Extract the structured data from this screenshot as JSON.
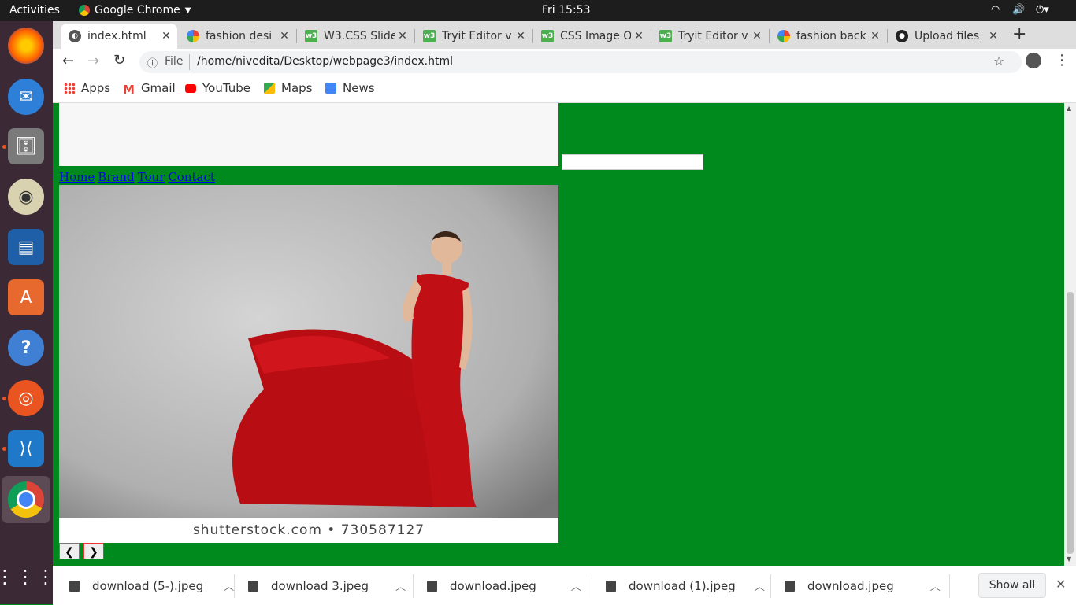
{
  "system": {
    "activities": "Activities",
    "app_name": "Google Chrome",
    "clock": "Fri 15:53"
  },
  "tabs": [
    {
      "title": "index.html",
      "active": true,
      "icon": "globe-icon"
    },
    {
      "title": "fashion desi",
      "icon": "google-icon"
    },
    {
      "title": "W3.CSS Slide",
      "icon": "w3-icon"
    },
    {
      "title": "Tryit Editor v",
      "icon": "w3-icon"
    },
    {
      "title": "CSS Image O",
      "icon": "w3-icon"
    },
    {
      "title": "Tryit Editor v",
      "icon": "w3-icon"
    },
    {
      "title": "fashion back",
      "icon": "google-icon"
    },
    {
      "title": "Upload files",
      "icon": "github-icon"
    }
  ],
  "toolbar": {
    "info_label": "File",
    "url": "/home/nivedita/Desktop/webpage3/index.html"
  },
  "bookmarks": [
    {
      "label": "Apps",
      "icon": "apps-grid-icon"
    },
    {
      "label": "Gmail",
      "icon": "gmail-icon"
    },
    {
      "label": "YouTube",
      "icon": "youtube-icon"
    },
    {
      "label": "Maps",
      "icon": "maps-icon"
    },
    {
      "label": "News",
      "icon": "news-icon"
    }
  ],
  "page": {
    "nav": [
      "Home",
      "Brand",
      "Tour",
      "Contact"
    ],
    "slide_caption": "shutterstock.com • 730587127",
    "prev_label": "❮",
    "next_label": "❯",
    "background_color": "#008a1d"
  },
  "downloads": {
    "items": [
      {
        "name": "download (5-).jpeg"
      },
      {
        "name": "download 3.jpeg"
      },
      {
        "name": "download.jpeg"
      },
      {
        "name": "download (1).jpeg"
      },
      {
        "name": "download.jpeg"
      }
    ],
    "show_all": "Show all"
  }
}
